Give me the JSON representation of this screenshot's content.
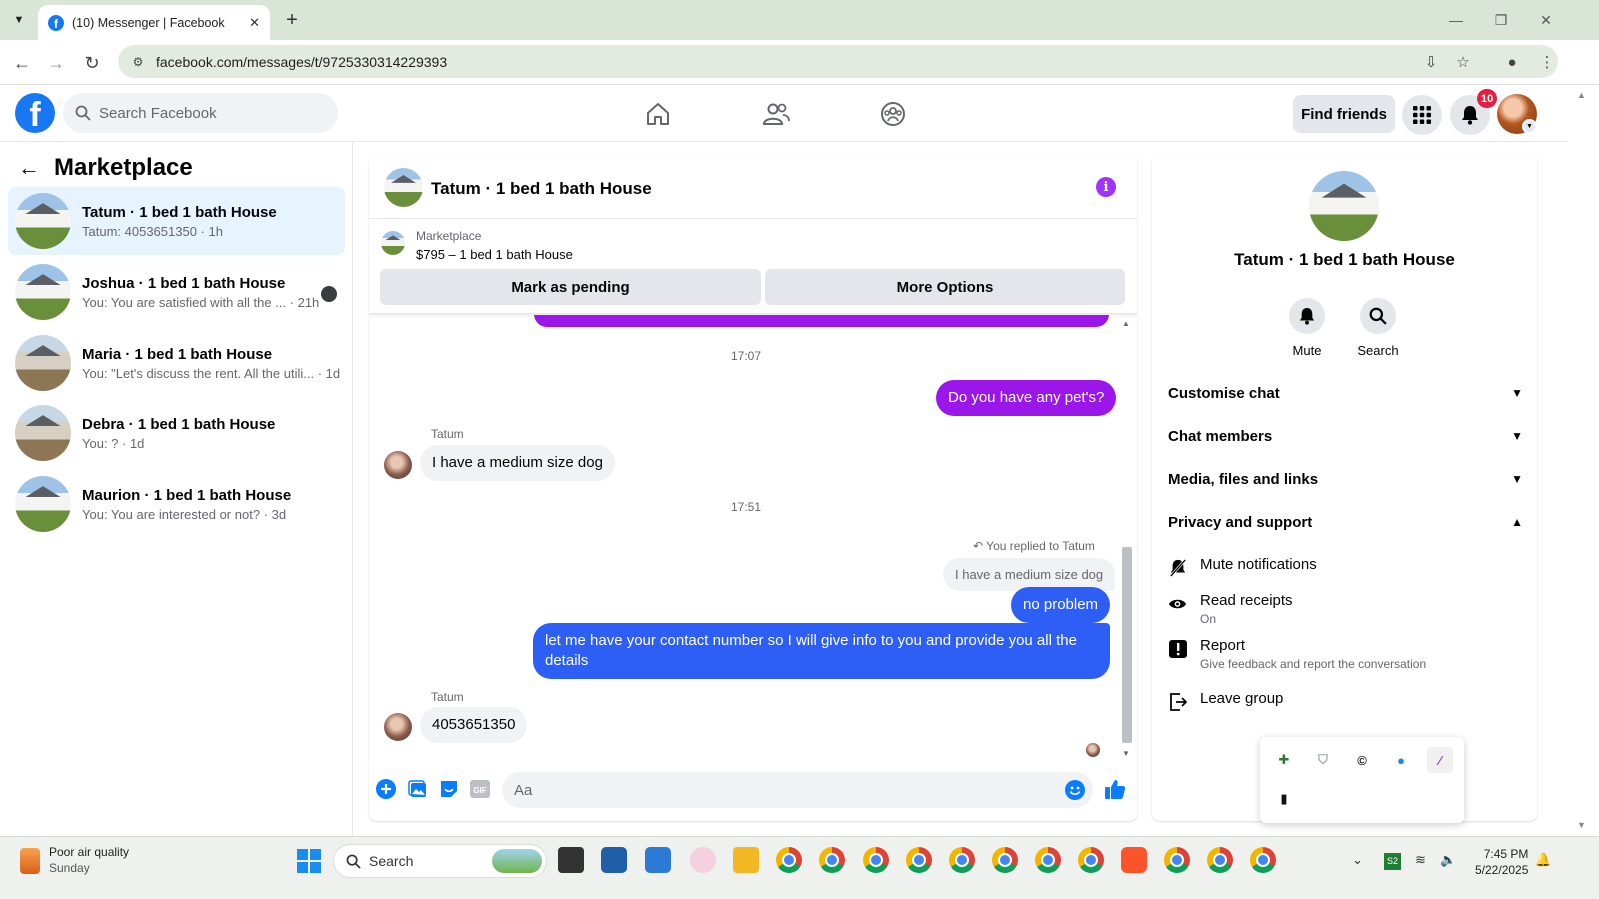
{
  "browser": {
    "tab_title": "(10) Messenger | Facebook",
    "url": "facebook.com/messages/t/9725330314229393"
  },
  "fb_header": {
    "search_placeholder": "Search Facebook",
    "find_friends_label": "Find friends",
    "notification_count": "10"
  },
  "left_panel": {
    "title": "Marketplace",
    "conversations": [
      {
        "name": "Tatum · 1 bed 1 bath House",
        "preview": "Tatum: 4053651350 · 1h",
        "active": true
      },
      {
        "name": "Joshua · 1 bed 1 bath House",
        "preview": "You: You are satisfied with all the ... · 21h"
      },
      {
        "name": "Maria · 1 bed 1 bath House",
        "preview": "You: \"Let's discuss the rent. All the utili... · 1d"
      },
      {
        "name": "Debra · 1 bed 1 bath House",
        "preview": "You: ? · 1d"
      },
      {
        "name": "Maurion · 1 bed 1 bath House",
        "preview": "You: You are interested or not? · 3d"
      }
    ]
  },
  "chat": {
    "title": "Tatum · 1 bed 1 bath House",
    "marketplace_label": "Marketplace",
    "listing": "$795 – 1 bed 1 bath House",
    "mark_pending_label": "Mark as pending",
    "more_options_label": "More Options",
    "messages": {
      "time_1": "17:07",
      "out_1": "Do you have any pet's?",
      "sender_1": "Tatum",
      "in_1": "I have a medium size dog",
      "time_2": "17:51",
      "reply_hint": "You replied to Tatum",
      "quoted": "I have a medium size dog",
      "out_2": "no problem",
      "out_3": "let me have your contact number so I will give info to you and provide you all the details",
      "sender_2": "Tatum",
      "in_2": "4053651350"
    },
    "composer_placeholder": "Aa"
  },
  "right_panel": {
    "name": "Tatum · 1 bed 1 bath House",
    "mute_label": "Mute",
    "search_label": "Search",
    "sections": {
      "customise": "Customise chat",
      "members": "Chat members",
      "media": "Media, files and links",
      "privacy": "Privacy and support"
    },
    "privacy_items": {
      "mute_notifications": "Mute notifications",
      "read_receipts": "Read receipts",
      "read_receipts_value": "On",
      "report": "Report",
      "report_desc": "Give feedback and report the conversation",
      "leave_group": "Leave group"
    }
  },
  "taskbar": {
    "weather_title": "Poor air quality",
    "weather_day": "Sunday",
    "search_label": "Search",
    "time": "7:45 PM",
    "date": "5/22/2025"
  },
  "colors": {
    "facebook_blue": "#1877f2",
    "messenger_purple": "#9b16e8",
    "messenger_blue": "#2d5ef5",
    "active_convo_bg": "#e7f3ff",
    "badge_red": "#e41e3f"
  }
}
